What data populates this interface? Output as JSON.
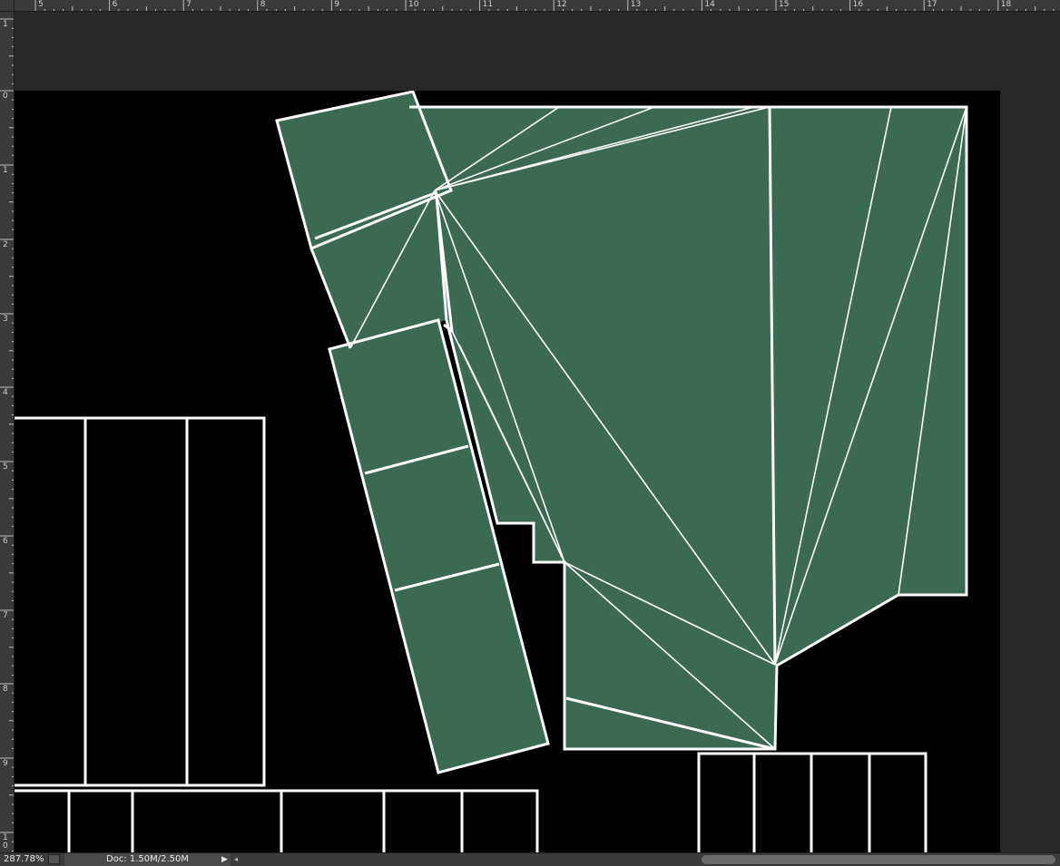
{
  "rulers": {
    "horizontal_labels": [
      "5",
      "6",
      "7",
      "8",
      "9",
      "10",
      "11",
      "12",
      "13",
      "14",
      "15",
      "16",
      "17",
      "18"
    ],
    "vertical_labels": [
      "1",
      "0",
      "1",
      "2",
      "3",
      "4",
      "5",
      "6",
      "7",
      "8",
      "9",
      "10"
    ]
  },
  "canvas": {
    "background": "#000000",
    "fill_color": "#3a6a52",
    "stroke_color": "#ffffff"
  },
  "status_bar": {
    "zoom": "287.78%",
    "doc_info": "Doc: 1.50M/2.50M",
    "menu_arrow": "▶",
    "scroll_left_arrow": "◂"
  }
}
